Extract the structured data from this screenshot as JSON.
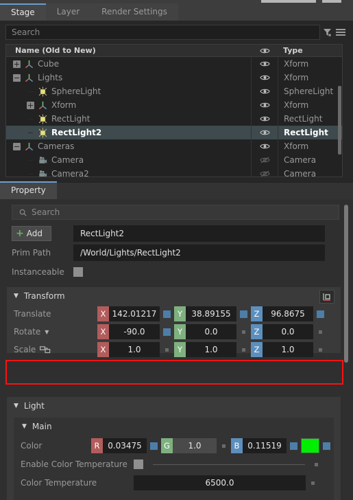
{
  "window": {
    "top_tabs": [
      {
        "label": "Stage",
        "active": true
      },
      {
        "label": "Layer",
        "active": false
      },
      {
        "label": "Render Settings",
        "active": false
      }
    ]
  },
  "stage": {
    "search_placeholder": "Search",
    "filter_icon": "filter-funnel-icon",
    "menu_icon": "hamburger-menu-icon",
    "tree": {
      "columns": {
        "name": "Name (Old to New)",
        "eye": "eye-icon",
        "type": "Type"
      },
      "rows": [
        {
          "name": "Cube",
          "type": "Xform",
          "indent": 1,
          "expander": "plus",
          "icon": "xform-axis-icon",
          "visible": true,
          "selected": false
        },
        {
          "name": "Lights",
          "type": "Xform",
          "indent": 1,
          "expander": "minus",
          "icon": "xform-axis-icon",
          "visible": true,
          "selected": false
        },
        {
          "name": "SphereLight",
          "type": "SphereLight",
          "indent": 2,
          "expander": "none",
          "icon": "light-bulb-icon",
          "visible": true,
          "selected": false
        },
        {
          "name": "Xform",
          "type": "Xform",
          "indent": 2,
          "expander": "plus",
          "icon": "xform-axis-icon",
          "visible": true,
          "selected": false
        },
        {
          "name": "RectLight",
          "type": "RectLight",
          "indent": 2,
          "expander": "none",
          "icon": "light-bulb-icon",
          "visible": true,
          "selected": false
        },
        {
          "name": "RectLight2",
          "type": "RectLight",
          "indent": 2,
          "expander": "none",
          "icon": "light-bulb-icon",
          "visible": true,
          "selected": true
        },
        {
          "name": "Cameras",
          "type": "Xform",
          "indent": 1,
          "expander": "minus",
          "icon": "xform-axis-icon",
          "visible": true,
          "selected": false
        },
        {
          "name": "Camera",
          "type": "Camera",
          "indent": 2,
          "expander": "none",
          "icon": "camera-icon",
          "visible": false,
          "selected": false
        },
        {
          "name": "Camera2",
          "type": "Camera",
          "indent": 2,
          "expander": "none",
          "icon": "camera-icon",
          "visible": false,
          "selected": false
        }
      ]
    }
  },
  "property": {
    "tab_label": "Property",
    "search_placeholder": "Search",
    "add_button": "Add",
    "prim_name_value": "RectLight2",
    "prim_path_label": "Prim Path",
    "prim_path_value": "/World/Lights/RectLight2",
    "instanceable_label": "Instanceable",
    "instanceable_checked": false,
    "transform": {
      "title": "Transform",
      "gizmo_icon": "transform-axes-icon",
      "rows": [
        {
          "label": "Translate",
          "icon": null,
          "dropdown": false,
          "axes": [
            {
              "axis": "X",
              "value": "142.01217",
              "indicator": "blue"
            },
            {
              "axis": "Y",
              "value": "38.89155",
              "indicator": "blue"
            },
            {
              "axis": "Z",
              "value": "96.8675",
              "indicator": "blue"
            }
          ]
        },
        {
          "label": "Rotate",
          "icon": null,
          "dropdown": true,
          "axes": [
            {
              "axis": "X",
              "value": "-90.0",
              "indicator": "blue"
            },
            {
              "axis": "Y",
              "value": "0.0",
              "indicator": "gray"
            },
            {
              "axis": "Z",
              "value": "0.0",
              "indicator": "gray"
            }
          ]
        },
        {
          "label": "Scale",
          "icon": "link-chain-icon",
          "dropdown": false,
          "highlighted": true,
          "axes": [
            {
              "axis": "X",
              "value": "1.0",
              "indicator": "gray"
            },
            {
              "axis": "Y",
              "value": "1.0",
              "indicator": "gray"
            },
            {
              "axis": "Z",
              "value": "1.0",
              "indicator": "gray"
            }
          ]
        }
      ]
    },
    "light": {
      "title": "Light",
      "main_title": "Main",
      "color_label": "Color",
      "color_channels": [
        {
          "axis": "R",
          "value": "0.03475",
          "indicator": "blue",
          "hover": false
        },
        {
          "axis": "G",
          "value": "1.0",
          "indicator": "gray",
          "hover": true
        },
        {
          "axis": "B",
          "value": "0.11519",
          "indicator": "blue",
          "hover": false
        }
      ],
      "color_swatch": "#00ef00",
      "enable_color_temperature_label": "Enable Color Temperature",
      "enable_color_temperature_checked": false,
      "color_temperature_label": "Color Temperature",
      "color_temperature_value": "6500.0"
    }
  },
  "colors": {
    "accent_tab": "#6a9ed0",
    "axis_x": "#b35c5c",
    "axis_y": "#7fb07f",
    "axis_z": "#5d8fbd",
    "highlight": "#ff1111",
    "add_plus": "#5eb85e"
  }
}
